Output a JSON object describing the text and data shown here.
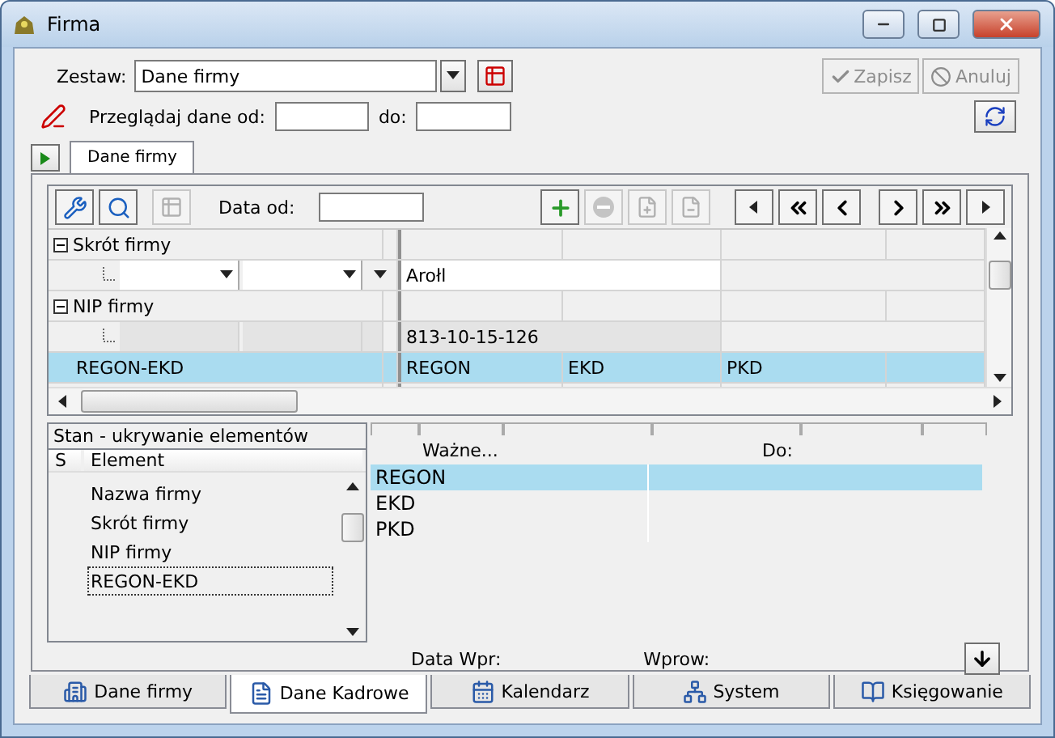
{
  "window": {
    "title": "Firma"
  },
  "zestaw": {
    "label": "Zestaw:",
    "value": "Dane firmy"
  },
  "actions": [
    {
      "label": "Zapisz",
      "disabled": true
    },
    {
      "label": "Anuluj",
      "disabled": true
    }
  ],
  "browse": {
    "label": "Przeglądaj dane od:",
    "to_label": "do:"
  },
  "tabs": [
    {
      "label": "Dane firmy",
      "selected": true
    }
  ],
  "toolbar": {
    "date_label": "Data od:"
  },
  "grid": {
    "rows": [
      {
        "kind": "group",
        "label": "Skrót firmy",
        "expanded": true
      },
      {
        "kind": "edit",
        "value": "Arołl"
      },
      {
        "kind": "group",
        "label": "NIP firmy",
        "expanded": true
      },
      {
        "kind": "readonly",
        "value": "813-10-15-126"
      },
      {
        "kind": "header",
        "label": "REGON-EKD",
        "selected": true,
        "cells": [
          "REGON",
          "EKD",
          "PKD"
        ]
      }
    ]
  },
  "hide_panel": {
    "title": "Stan - ukrywanie elementów",
    "columns": [
      "S",
      "Element"
    ],
    "items": [
      {
        "label": "Nazwa firmy",
        "selected": false
      },
      {
        "label": "Skrót firmy",
        "selected": false
      },
      {
        "label": "NIP firmy",
        "selected": false
      },
      {
        "label": "REGON-EKD",
        "selected": true
      }
    ]
  },
  "detail": {
    "columns": [
      "Ważne...",
      "Do:"
    ],
    "rows": [
      {
        "label": "REGON",
        "selected": true
      },
      {
        "label": "EKD",
        "selected": false
      },
      {
        "label": "PKD",
        "selected": false
      }
    ]
  },
  "footer": [
    "Data Wpr:",
    "Wprow:"
  ],
  "bottom_tabs": [
    {
      "label": "Dane firmy",
      "selected": false
    },
    {
      "label": "Dane Kadrowe",
      "selected": true
    },
    {
      "label": "Kalendarz",
      "selected": false
    },
    {
      "label": "System",
      "selected": false
    },
    {
      "label": "Księgowanie",
      "selected": false
    }
  ]
}
